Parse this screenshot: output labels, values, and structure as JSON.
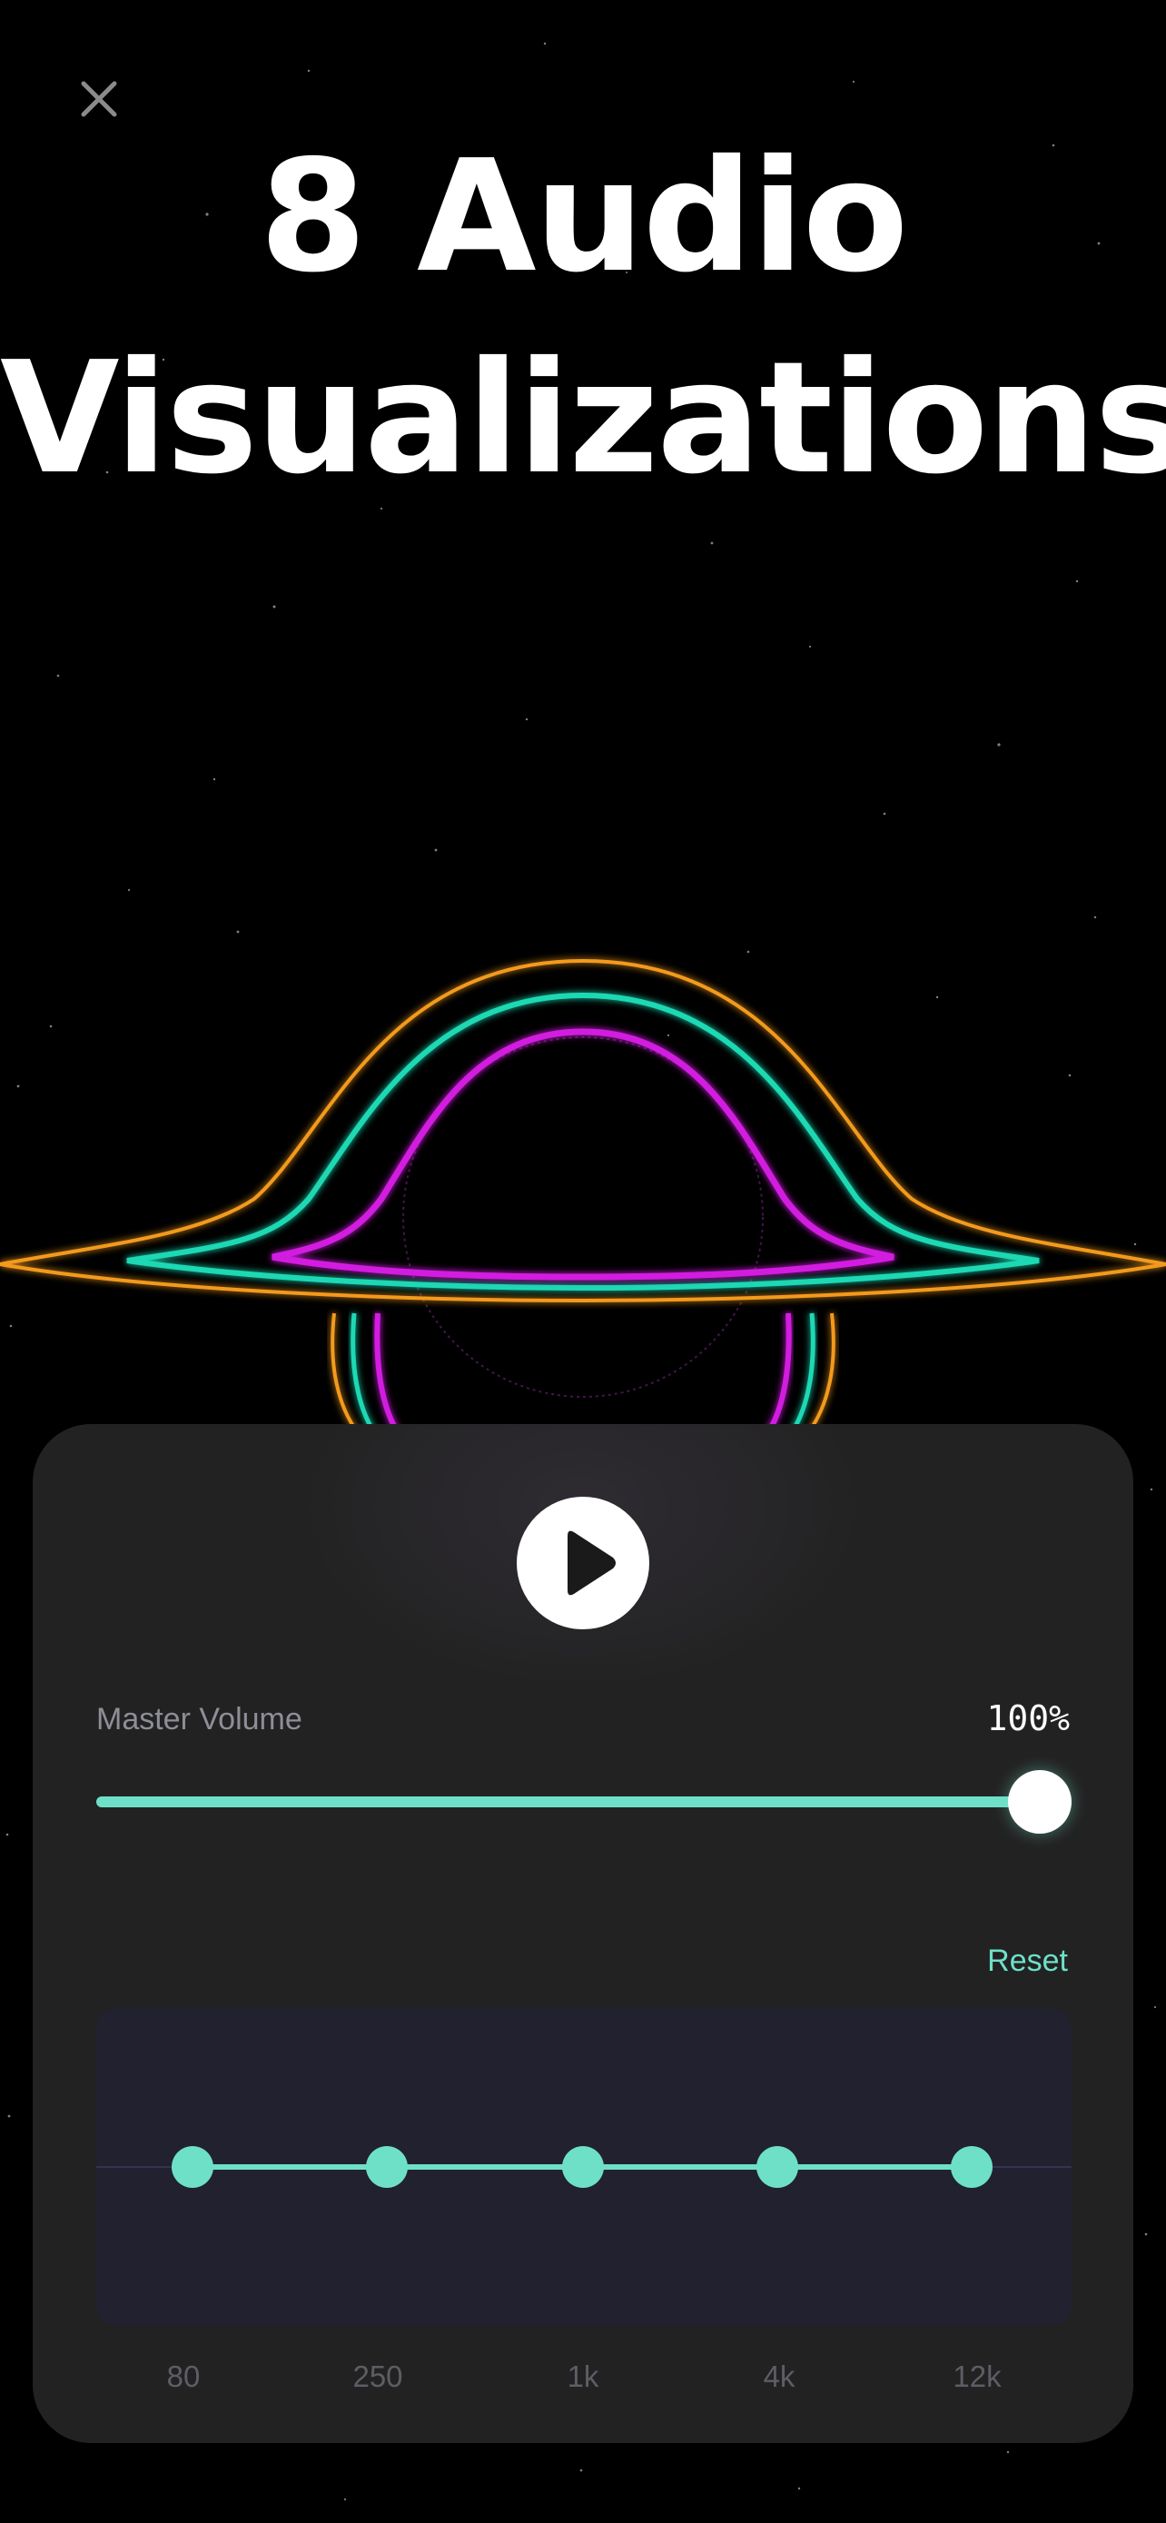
{
  "header": {
    "close_icon": "close-icon",
    "title_line1": "8 Audio",
    "title_line2": "Visualizations"
  },
  "visualization": {
    "name": "black-hole-visualization",
    "ring_colors": [
      "#f39a1c",
      "#1fd9b4",
      "#d21ee0"
    ]
  },
  "player": {
    "play_icon": "play-icon",
    "volume_label": "Master Volume",
    "volume_value_text": "100%",
    "volume_fraction": 1.0,
    "reset_label": "Reset",
    "eq_bands": [
      {
        "label": "80",
        "gain": 0
      },
      {
        "label": "250",
        "gain": 0
      },
      {
        "label": "1k",
        "gain": 0
      },
      {
        "label": "4k",
        "gain": 0
      },
      {
        "label": "12k",
        "gain": 0
      }
    ]
  },
  "colors": {
    "background": "#000000",
    "panel": "#222222",
    "accent": "#6ee0c8",
    "eq_background": "#212130"
  }
}
